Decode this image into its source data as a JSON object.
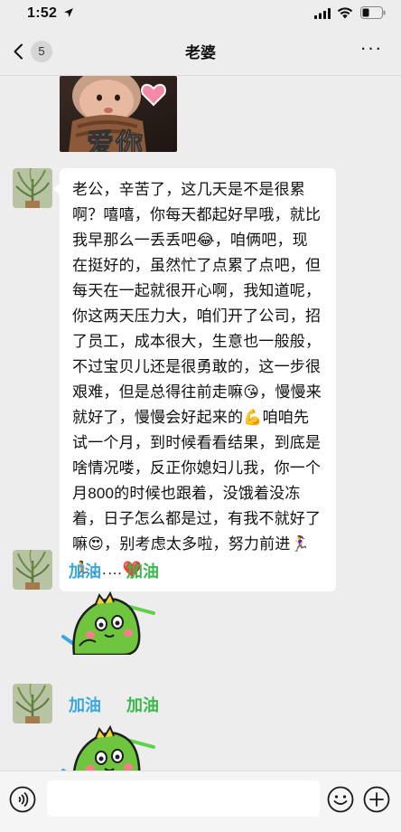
{
  "status_bar": {
    "time": "1:52"
  },
  "nav": {
    "back_count": "5",
    "title": "老婆",
    "more": "···"
  },
  "messages": {
    "photo_sticker": {
      "caption": "爱你"
    },
    "text_message": "老公，辛苦了，这几天是不是很累啊？嘻嘻，你每天都起好早哦，就比我早那么一丢丢吧😂，咱俩吧，现在挺好的，虽然忙了点累了点吧，但每天在一起就很开心啊，我知道呢，你这两天压力大，咱们开了公司，招了员工，成本很大，生意也一般般，不过宝贝儿还是很勇敢的，这一步很艰难，但是总得往前走嘛😘，慢慢来就好了，慢慢会好起来的💪咱咱先试一个月，到时候看看结果，到底是啥情况喽，反正你媳妇儿我，你一个月800的时候也跟着，没饿着没冻着，日子怎么都是过，有我不就好了嘛😍，别考虑太多啦，努力前进🏃‍♀️🏃……❤️",
    "sticker_1": {
      "text_a": "加油",
      "text_b": "加油"
    },
    "sticker_2": {
      "text_a": "加油",
      "text_b": "加油"
    }
  },
  "input": {
    "value": "",
    "placeholder": ""
  },
  "colors": {
    "background": "#ededed",
    "bubble": "#ffffff",
    "sticker_blue": "#39a7e0",
    "sticker_green": "#39b84b"
  }
}
